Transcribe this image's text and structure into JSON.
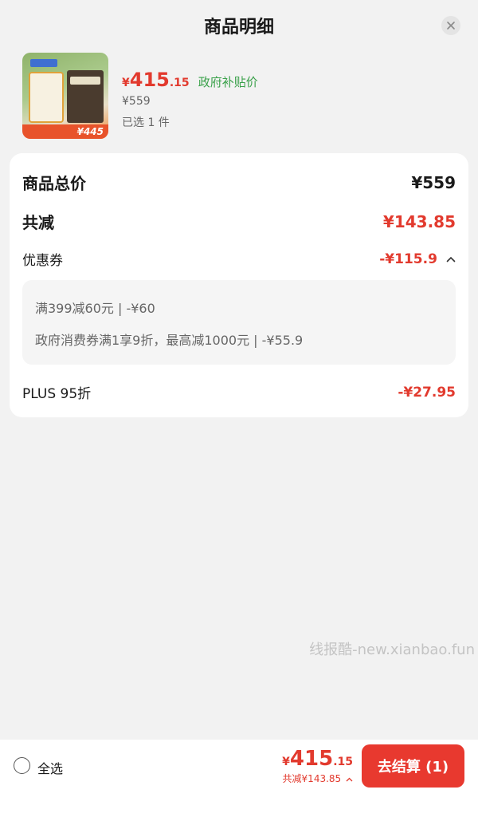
{
  "header": {
    "title": "商品明细",
    "close_icon": "close-icon"
  },
  "product": {
    "badge_price": "¥445",
    "price_symbol": "¥",
    "price_int": "415",
    "price_dec": ".15",
    "subsidy_label": "政府补贴价",
    "original_price": "¥559",
    "selected_count": "已选 1 件"
  },
  "detail": {
    "total_label": "商品总价",
    "total_value": "¥559",
    "reduce_label": "共减",
    "reduce_value": "¥143.85",
    "coupon_label": "优惠券",
    "coupon_value": "-¥115.9",
    "coupons": [
      "满399减60元 | -¥60",
      "政府消费券满1享9折，最高减1000元 | -¥55.9"
    ],
    "plus_label": "PLUS 95折",
    "plus_value": "-¥27.95"
  },
  "watermark": "线报酷-new.xianbao.fun",
  "footer": {
    "select_all": "全选",
    "price_symbol": "¥",
    "price_int": "415",
    "price_dec": ".15",
    "reduce_text": "共减¥143.85",
    "checkout_label": "去结算 (1)"
  },
  "colors": {
    "accent_red": "#e23a2e",
    "subsidy_green": "#3aa14a",
    "checkout_bg": "#e8392f"
  }
}
